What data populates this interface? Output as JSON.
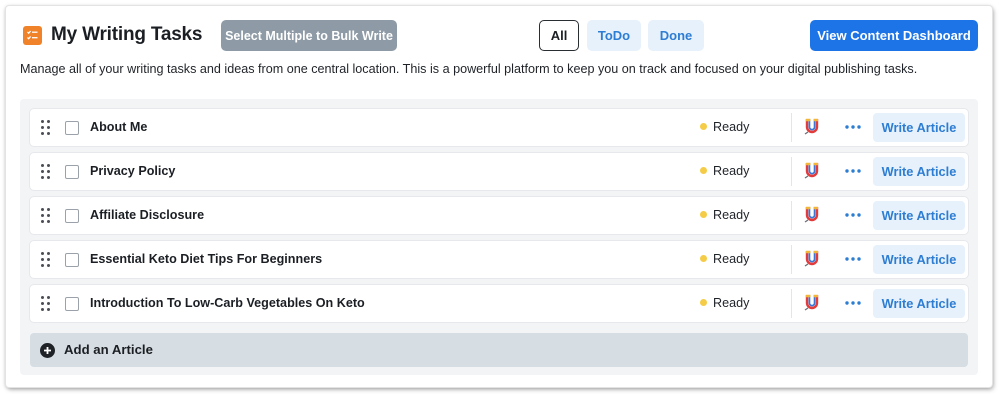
{
  "header": {
    "title": "My Writing Tasks",
    "logo_icon": "checklist-icon",
    "bulk_write_label": "Select Multiple to Bulk Write",
    "filters": {
      "all": "All",
      "todo": "ToDo",
      "done": "Done"
    },
    "active_filter": "All",
    "dashboard_label": "View Content Dashboard"
  },
  "description": "Manage all of your writing tasks and ideas from one central location. This is a powerful platform to keep you on track and focused on your digital publishing tasks.",
  "tasks": [
    {
      "title": "About Me",
      "status": "Ready",
      "action": "Write Article"
    },
    {
      "title": "Privacy Policy",
      "status": "Ready",
      "action": "Write Article"
    },
    {
      "title": "Affiliate Disclosure",
      "status": "Ready",
      "action": "Write Article"
    },
    {
      "title": "Essential Keto Diet Tips For Beginners",
      "status": "Ready",
      "action": "Write Article"
    },
    {
      "title": "Introduction To Low-Carb Vegetables On Keto",
      "status": "Ready",
      "action": "Write Article"
    }
  ],
  "add_article_label": "Add an Article",
  "colors": {
    "primary": "#1d74e6",
    "accent_text": "#2d7dd2",
    "accent_bg": "#e7f1fc",
    "logo": "#f0832a",
    "status_ready": "#f5cc47",
    "bulk_button": "#8e9aa5"
  },
  "icons": [
    "checklist-icon",
    "drag-handle-icon",
    "magnet-icon",
    "more-options-icon",
    "plus-circle-icon"
  ]
}
